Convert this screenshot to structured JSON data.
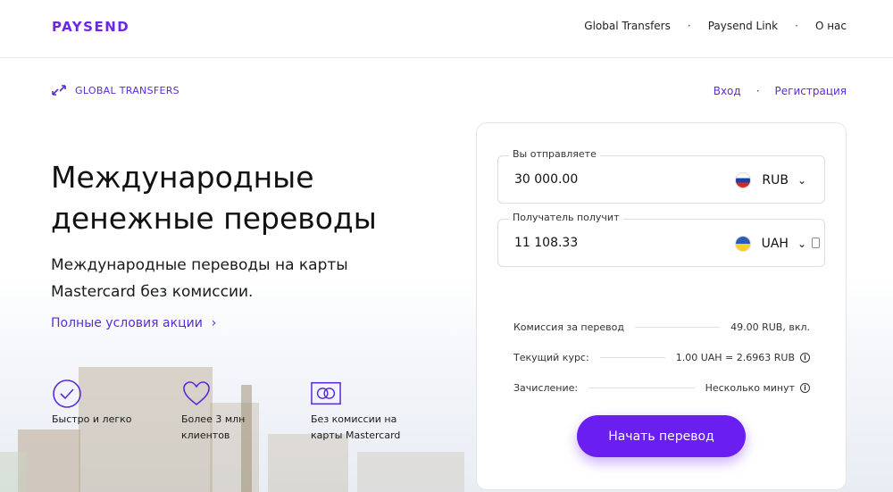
{
  "header": {
    "logo": "PAYSEND",
    "nav": [
      {
        "label": "Global Transfers"
      },
      {
        "label": "Paysend Link"
      },
      {
        "label": "О нас"
      }
    ],
    "separator": "·"
  },
  "subheader": {
    "section_label": "GLOBAL TRANSFERS",
    "login": "Вход",
    "register": "Регистрация",
    "separator": "·"
  },
  "hero": {
    "title": "Международные денежные переводы",
    "subtitle": "Международные переводы на карты Mastercard без комиссии.",
    "terms_link": "Полные условия акции",
    "terms_chevron": "›"
  },
  "features": [
    {
      "icon": "check-circle-icon",
      "text": "Быстро и легко"
    },
    {
      "icon": "heart-icon",
      "text": "Более 3 млн клиентов"
    },
    {
      "icon": "mastercard-icon",
      "text": "Без комиссии на карты Mastercard"
    }
  ],
  "calculator": {
    "send": {
      "label": "Вы отправляете",
      "amount": "30 000.00",
      "currency": "RUB",
      "flag": "russia-flag-icon"
    },
    "receive": {
      "label": "Получатель получит",
      "amount": "11 108.33",
      "currency": "UAH",
      "flag": "ukraine-flag-icon"
    },
    "chevron": "⌄",
    "info_glyph": "i",
    "rows": [
      {
        "label": "Комиссия за перевод",
        "value": "49.00 RUB, вкл."
      },
      {
        "label": "Текущий курс:",
        "value": "1.00 UAH = 2.6963 RUB"
      },
      {
        "label": "Зачисление:",
        "value": "Несколько минут"
      }
    ],
    "cta": "Начать перевод"
  },
  "colors": {
    "brand": "#6a1ef0",
    "link": "#5a2bd9"
  }
}
